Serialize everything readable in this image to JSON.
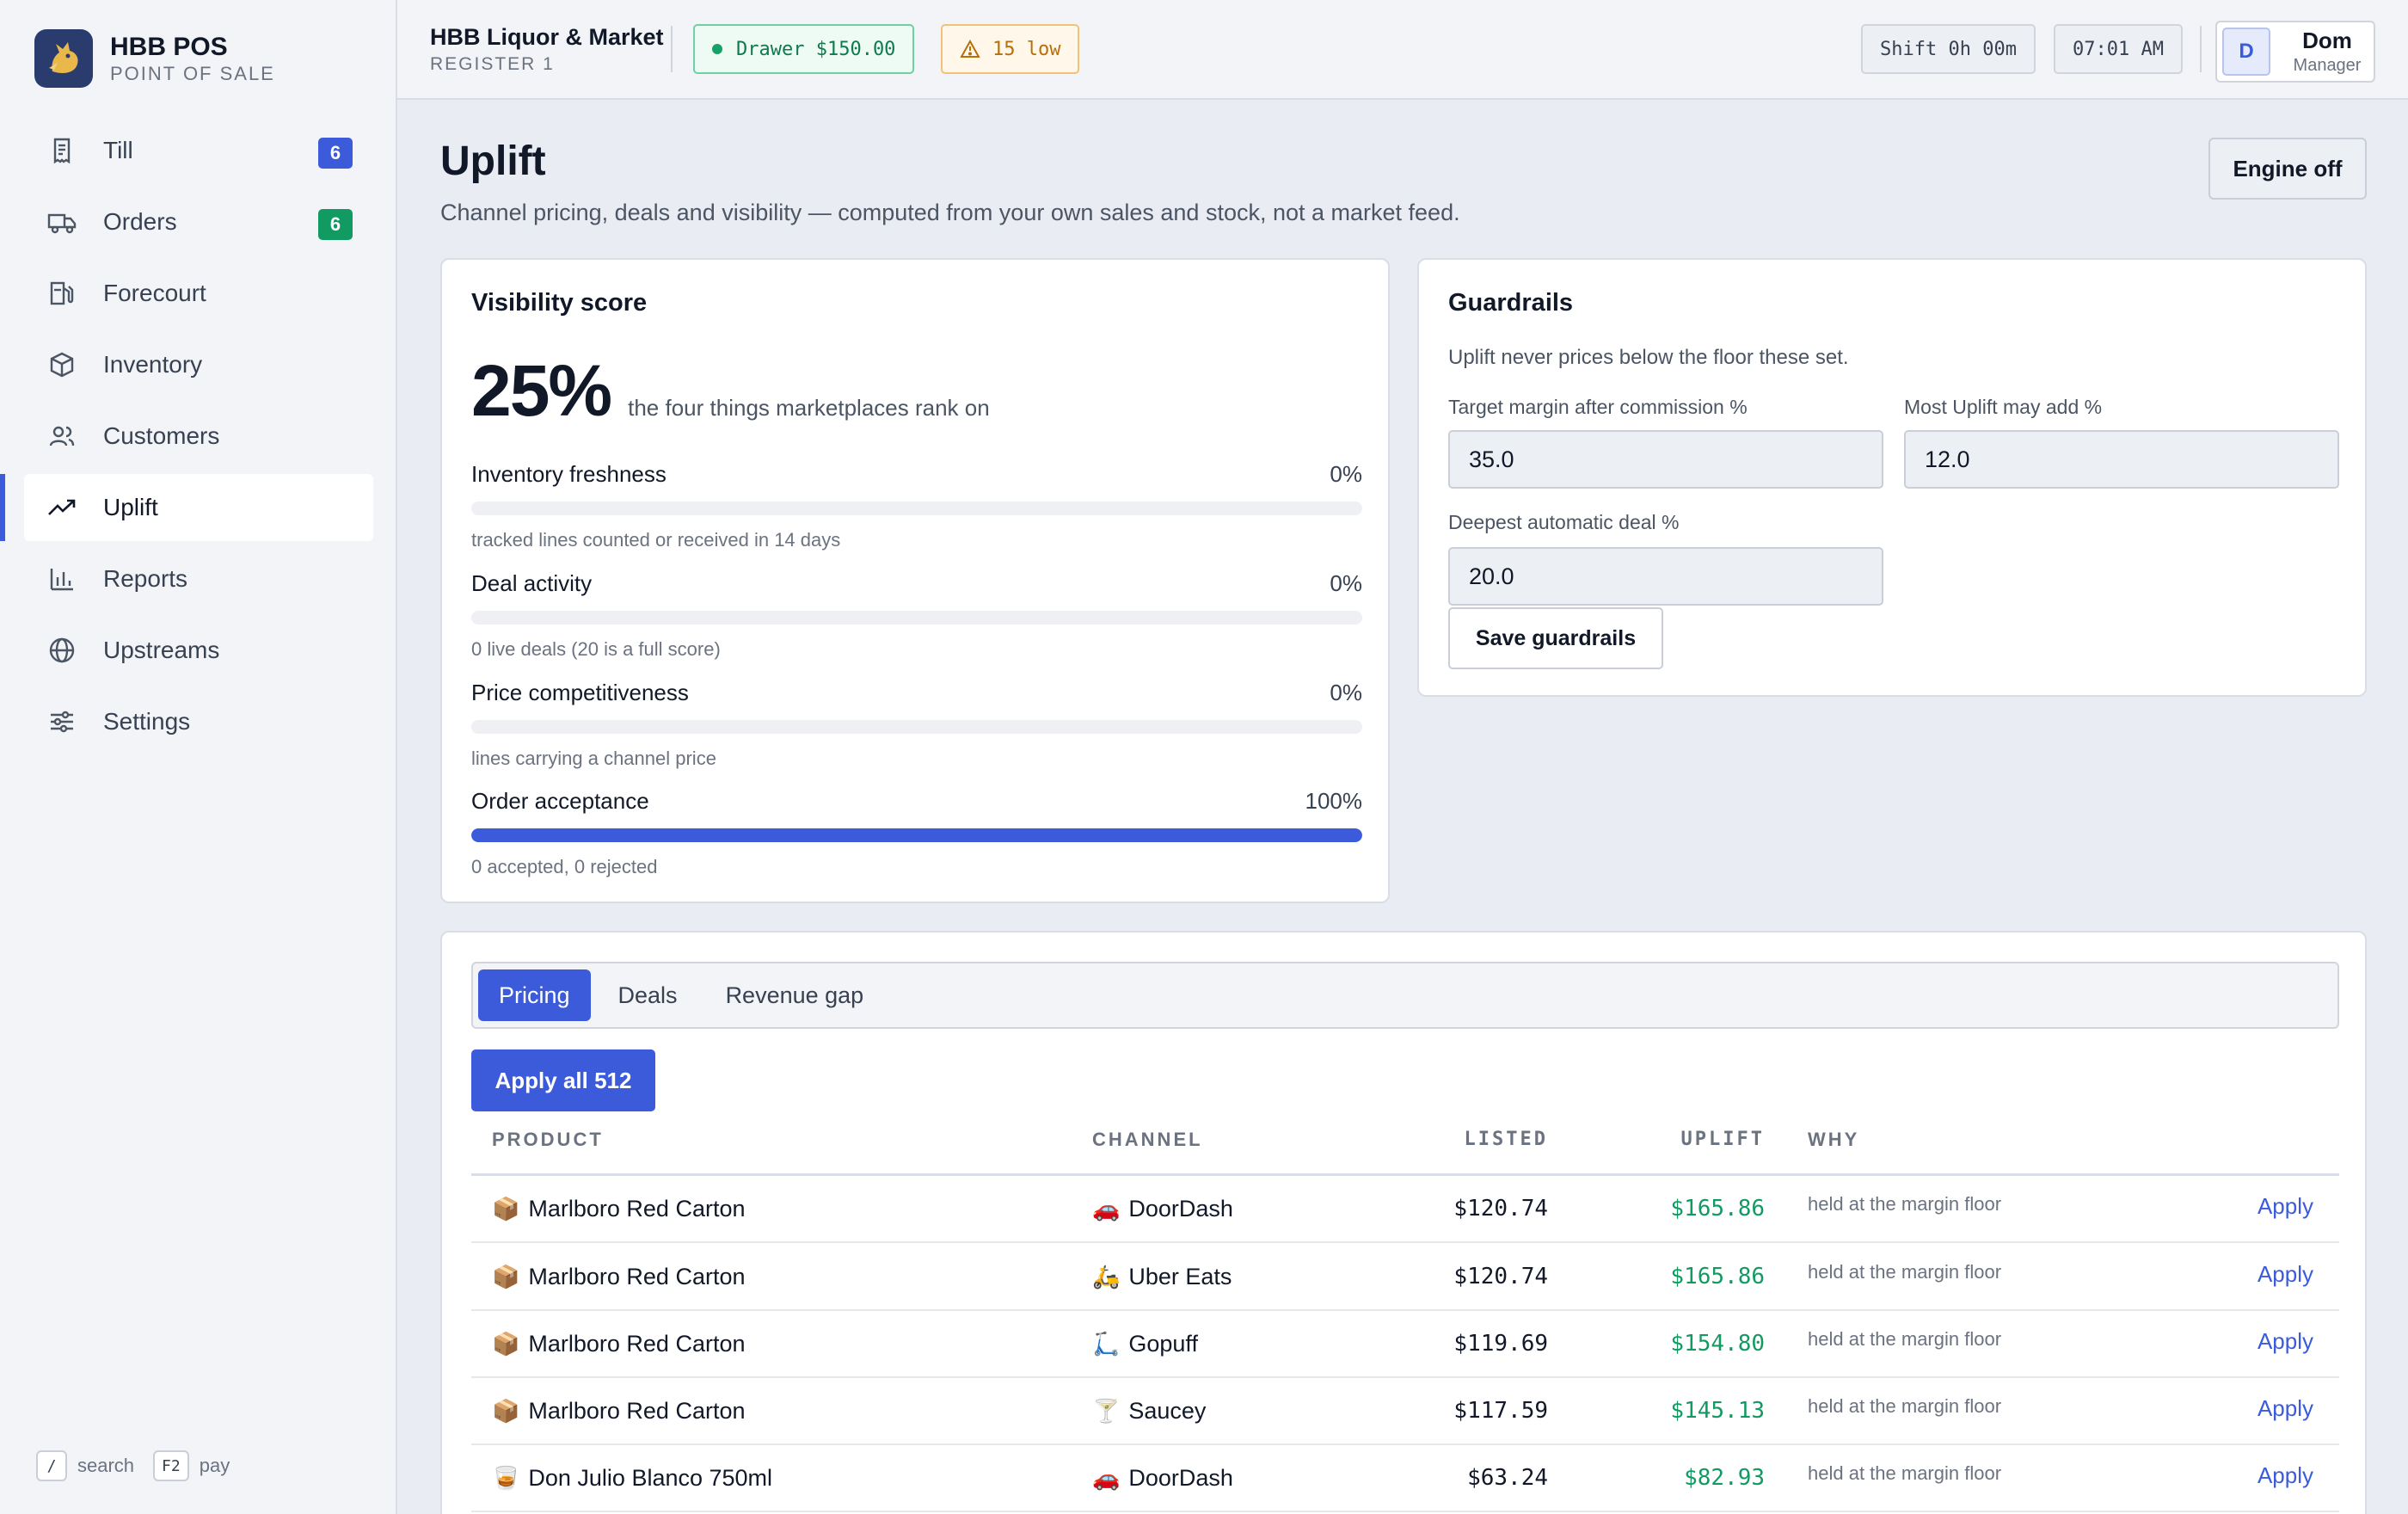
{
  "brand": {
    "name": "HBB POS",
    "subtitle": "POINT OF SALE"
  },
  "nav": [
    {
      "label": "Till",
      "icon": "receipt-icon",
      "badge": "6",
      "badge_color": "#3b5bdb"
    },
    {
      "label": "Orders",
      "icon": "truck-icon",
      "badge": "6",
      "badge_color": "#129a63"
    },
    {
      "label": "Forecourt",
      "icon": "fuel-pump-icon"
    },
    {
      "label": "Inventory",
      "icon": "box-icon"
    },
    {
      "label": "Customers",
      "icon": "users-icon"
    },
    {
      "label": "Uplift",
      "icon": "trending-up-icon",
      "active": true
    },
    {
      "label": "Reports",
      "icon": "bar-chart-icon"
    },
    {
      "label": "Upstreams",
      "icon": "globe-icon"
    },
    {
      "label": "Settings",
      "icon": "sliders-icon"
    }
  ],
  "hotkeys": [
    {
      "key": "/",
      "label": "search"
    },
    {
      "key": "F2",
      "label": "pay"
    }
  ],
  "topbar": {
    "store_name": "HBB Liquor & Market",
    "register": "REGISTER 1",
    "drawer": "Drawer $150.00",
    "low_stock": "15 low",
    "shift": "Shift 0h 00m",
    "time": "07:01 AM",
    "user_initial": "D",
    "user_name": "Dom",
    "user_role": "Manager"
  },
  "page": {
    "title": "Uplift",
    "subtitle": "Channel pricing, deals and visibility — computed from your own sales and stock, not a market feed.",
    "engine_button": "Engine off"
  },
  "visibility": {
    "title": "Visibility score",
    "score": "25%",
    "score_label": "the four things marketplaces rank on",
    "metrics": [
      {
        "label": "Inventory freshness",
        "pct": "0%",
        "fill": 0,
        "note": "tracked lines counted or received in 14 days"
      },
      {
        "label": "Deal activity",
        "pct": "0%",
        "fill": 0,
        "note": "0 live deals (20 is a full score)"
      },
      {
        "label": "Price competitiveness",
        "pct": "0%",
        "fill": 0,
        "note": "lines carrying a channel price"
      },
      {
        "label": "Order acceptance",
        "pct": "100%",
        "fill": 1,
        "note": "0 accepted, 0 rejected"
      }
    ]
  },
  "guardrails": {
    "title": "Guardrails",
    "note": "Uplift never prices below the floor these set.",
    "target_margin_label": "Target margin after commission %",
    "target_margin_value": "35.0",
    "max_uplift_label": "Most Uplift may add %",
    "max_uplift_value": "12.0",
    "deepest_deal_label": "Deepest automatic deal %",
    "deepest_deal_value": "20.0",
    "save_label": "Save guardrails"
  },
  "tabs": [
    {
      "label": "Pricing",
      "active": true
    },
    {
      "label": "Deals"
    },
    {
      "label": "Revenue gap"
    }
  ],
  "apply_all": "Apply all 512",
  "table": {
    "headers": {
      "product": "PRODUCT",
      "channel": "CHANNEL",
      "listed": "LISTED",
      "uplift": "UPLIFT",
      "why": "WHY"
    },
    "rows": [
      {
        "product_icon": "📦",
        "product": "Marlboro Red Carton",
        "channel_icon": "🚗",
        "channel": "DoorDash",
        "listed": "$120.74",
        "uplift": "$165.86",
        "why": "held at the margin floor",
        "action": "Apply"
      },
      {
        "product_icon": "📦",
        "product": "Marlboro Red Carton",
        "channel_icon": "🛵",
        "channel": "Uber Eats",
        "listed": "$120.74",
        "uplift": "$165.86",
        "why": "held at the margin floor",
        "action": "Apply"
      },
      {
        "product_icon": "📦",
        "product": "Marlboro Red Carton",
        "channel_icon": "🛴",
        "channel": "Gopuff",
        "listed": "$119.69",
        "uplift": "$154.80",
        "why": "held at the margin floor",
        "action": "Apply"
      },
      {
        "product_icon": "📦",
        "product": "Marlboro Red Carton",
        "channel_icon": "🍸",
        "channel": "Saucey",
        "listed": "$117.59",
        "uplift": "$145.13",
        "why": "held at the margin floor",
        "action": "Apply"
      },
      {
        "product_icon": "🥃",
        "product": "Don Julio Blanco 750ml",
        "channel_icon": "🚗",
        "channel": "DoorDash",
        "listed": "$63.24",
        "uplift": "$82.93",
        "why": "held at the margin floor",
        "action": "Apply"
      }
    ]
  }
}
